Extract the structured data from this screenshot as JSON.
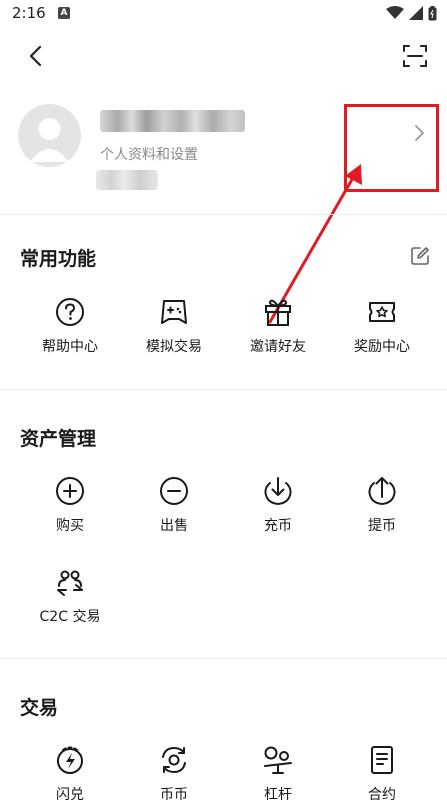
{
  "status_bar": {
    "time": "2:16",
    "notif_letter": "A"
  },
  "profile": {
    "subtitle": "个人资料和设置"
  },
  "sections": [
    {
      "title": "常用功能",
      "items": [
        {
          "label": "帮助中心",
          "icon": "help-circle-icon"
        },
        {
          "label": "模拟交易",
          "icon": "gamepad-icon"
        },
        {
          "label": "邀请好友",
          "icon": "gift-icon"
        },
        {
          "label": "奖励中心",
          "icon": "reward-ticket-icon"
        }
      ]
    },
    {
      "title": "资产管理",
      "items": [
        {
          "label": "购买",
          "icon": "plus-circle-icon"
        },
        {
          "label": "出售",
          "icon": "minus-circle-icon"
        },
        {
          "label": "充币",
          "icon": "deposit-arrow-icon"
        },
        {
          "label": "提币",
          "icon": "withdraw-arrow-icon"
        },
        {
          "label": "C2C 交易",
          "icon": "c2c-users-icon"
        }
      ]
    },
    {
      "title": "交易",
      "items": [
        {
          "label": "闪兑",
          "icon": "flash-swap-icon"
        },
        {
          "label": "币币",
          "icon": "coin-swap-icon"
        },
        {
          "label": "杠杆",
          "icon": "margin-icon"
        },
        {
          "label": "合约",
          "icon": "contract-doc-icon"
        }
      ]
    }
  ],
  "colors": {
    "annotation": "#e01b24",
    "text": "#1a1a1a",
    "muted": "#8a8a8a"
  }
}
